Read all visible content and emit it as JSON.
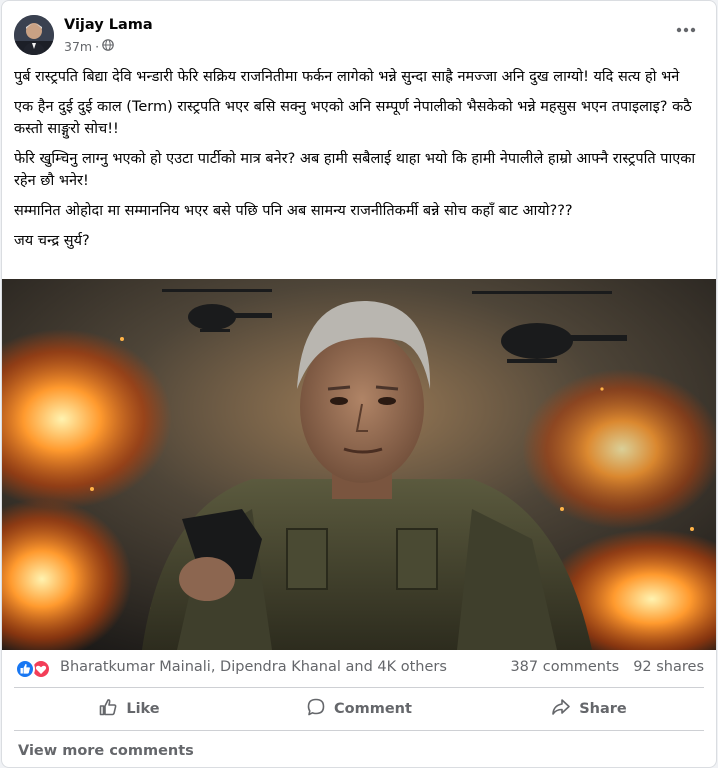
{
  "post": {
    "author": "Vijay Lama",
    "time": "37m",
    "time_separator": "·",
    "privacy_icon": "globe-icon",
    "more_icon": "more-options-icon",
    "paragraphs": [
      "पुर्ब रास्ट्रपति बिद्या देवि भन्डारी फेरि सक्रिय राजनितीमा फर्कन लागेको भन्ने सुन्दा साह्रै नमज्जा अनि दुख लाग्यो! यदि सत्य हो भने",
      "एक हैन दुई दुई काल (Term) रास्ट्रपति भएर बसि सक्नु भएको अनि सम्पूर्ण नेपालीको भैसकेको भन्ने महसुस भएन तपाइलाइ? कठै कस्तो साङ्गुरो सोच!!",
      "फेरि खुम्चिनु लाग्नु भएको हो एउटा पार्टीको मात्र बनेर? अब हामी सबैलाई थाहा भयो कि हामी नेपालीले हाम्रो आफ्नै रास्ट्रपति पाएका रहेन छौ भनेर!",
      "सम्मानित ओहोदा मा सम्माननिय भएर बसे पछि पनि अब सामन्य राजनीतिकर्मी बन्ने सोच कहाँ बाट आयो???",
      "जय चन्द्र सुर्य?"
    ]
  },
  "reactions": {
    "icons": [
      "like-reaction-icon",
      "love-reaction-icon"
    ],
    "names": "Bharatkumar Mainali, Dipendra Khanal and 4K others",
    "comments": "387 comments",
    "shares": "92 shares"
  },
  "actions": {
    "like": "Like",
    "comment": "Comment",
    "share": "Share"
  },
  "footer": {
    "view_more": "View more comments"
  },
  "colors": {
    "like_blue": "#1877f2",
    "love_red": "#f33e58",
    "secondary_text": "#65676b"
  }
}
